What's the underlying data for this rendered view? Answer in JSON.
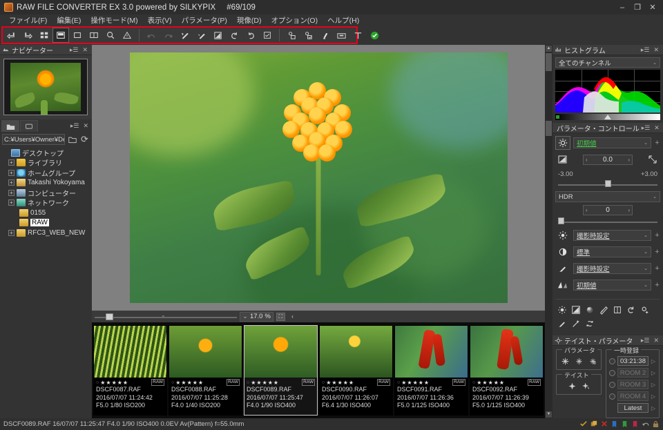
{
  "window": {
    "title": "RAW FILE CONVERTER EX 3.0 powered by SILKYPIX",
    "counter": "#69/109",
    "minimize": "–",
    "maximize": "❐",
    "close": "✕"
  },
  "menubar": [
    {
      "label": "ファイル(F)"
    },
    {
      "label": "編集(E)"
    },
    {
      "label": "操作モード(M)"
    },
    {
      "label": "表示(V)"
    },
    {
      "label": "パラメータ(P)"
    },
    {
      "label": "現像(D)"
    },
    {
      "label": "オプション(O)"
    },
    {
      "label": "ヘルプ(H)"
    }
  ],
  "toolbar": {
    "highlight_color": "#e8001a",
    "group1": [
      {
        "name": "prev-image-icon",
        "glyph": "⇤"
      },
      {
        "name": "next-image-icon",
        "glyph": "⇥"
      },
      {
        "name": "thumbnail-grid-icon",
        "glyph": "▦"
      },
      {
        "name": "filmstrip-view-icon",
        "glyph": "▤"
      },
      {
        "name": "single-view-icon",
        "glyph": "▢"
      },
      {
        "name": "split-view-icon",
        "glyph": "◫"
      },
      {
        "name": "magnifier-icon",
        "glyph": "🔍"
      },
      {
        "name": "warning-icon",
        "glyph": "⚠"
      }
    ],
    "group2": [
      {
        "name": "undo-icon",
        "glyph": "↶"
      },
      {
        "name": "redo-icon",
        "glyph": "↷"
      },
      {
        "name": "white-balance-icon",
        "glyph": "◩"
      },
      {
        "name": "gray-balance-icon",
        "glyph": "◪"
      },
      {
        "name": "exposure-icon",
        "glyph": "◨"
      },
      {
        "name": "rotate-left-icon",
        "glyph": "↺"
      },
      {
        "name": "rotate-right-icon",
        "glyph": "↻"
      },
      {
        "name": "check-box-icon",
        "glyph": "☑"
      }
    ],
    "group3": [
      {
        "name": "develop-one-icon",
        "glyph": "⚙"
      },
      {
        "name": "develop-batch-icon",
        "glyph": "⚙"
      },
      {
        "name": "brush-icon",
        "glyph": "🖌"
      },
      {
        "name": "printer-icon",
        "glyph": "🖶"
      },
      {
        "name": "lens-correction-icon",
        "glyph": "⊤"
      },
      {
        "name": "apply-ok-icon",
        "glyph": "✔"
      }
    ]
  },
  "navigator": {
    "title": "ナビゲーター",
    "menu_icon": "▸☰",
    "close_icon": "✕"
  },
  "folder_panel": {
    "tab_folder_icon": "📂",
    "tab_comment_icon": "🗩",
    "menu_icon": "▸☰",
    "close_icon": "✕",
    "path": "C:¥Users¥Owner¥De",
    "path_caret": "⌄",
    "new_folder_icon": "🗀",
    "refresh_icon": "⟳",
    "tree": [
      {
        "label": "デスクトップ",
        "depth": 0,
        "expander": "",
        "icon": "ico-desktop",
        "selected": false
      },
      {
        "label": "ライブラリ",
        "depth": 1,
        "expander": "+",
        "icon": "ico-folder",
        "selected": false
      },
      {
        "label": "ホームグループ",
        "depth": 1,
        "expander": "+",
        "icon": "ico-home",
        "selected": false
      },
      {
        "label": "Takashi Yokoyama",
        "depth": 1,
        "expander": "+",
        "icon": "ico-user",
        "selected": false
      },
      {
        "label": "コンピューター",
        "depth": 1,
        "expander": "+",
        "icon": "ico-comp",
        "selected": false
      },
      {
        "label": "ネットワーク",
        "depth": 1,
        "expander": "+",
        "icon": "ico-net",
        "selected": false
      },
      {
        "label": "0155",
        "depth": 2,
        "expander": "",
        "icon": "ico-folder-b",
        "selected": false
      },
      {
        "label": "RAW",
        "depth": 2,
        "expander": "",
        "icon": "ico-folder-b",
        "selected": true
      },
      {
        "label": "RFC3_WEB_NEW",
        "depth": 1,
        "expander": "+",
        "icon": "ico-folder-b",
        "selected": false
      }
    ]
  },
  "viewer": {
    "zoom_value": "17.0",
    "zoom_unit": "%",
    "zoom_caret": "⌄",
    "zoom_fit_icon": "⛶",
    "zoom_prev_icon": "‹"
  },
  "filmstrip": {
    "items": [
      {
        "filename": "DSCF0087.RAF",
        "datetime": "2016/07/07 11:24:42",
        "exif": "F5.0 1/80 ISO200",
        "rating": 5,
        "badge": "RAW",
        "selected": false,
        "kind": "fern"
      },
      {
        "filename": "DSCF0088.RAF",
        "datetime": "2016/07/07 11:25:28",
        "exif": "F4.0 1/40 ISO200",
        "rating": 5,
        "badge": "RAW",
        "selected": false,
        "kind": "lantana"
      },
      {
        "filename": "DSCF0089.RAF",
        "datetime": "2016/07/07 11:25:47",
        "exif": "F4.0 1/90 ISO400",
        "rating": 5,
        "badge": "RAW",
        "selected": true,
        "kind": "lantana"
      },
      {
        "filename": "DSCF0090.RAF",
        "datetime": "2016/07/07 11:26:07",
        "exif": "F6.4 1/30 ISO400",
        "rating": 5,
        "badge": "RAW",
        "selected": false,
        "kind": "lantana"
      },
      {
        "filename": "DSCF0091.RAF",
        "datetime": "2016/07/07 11:26:36",
        "exif": "F5.0 1/125 ISO400",
        "rating": 5,
        "badge": "RAW",
        "selected": false,
        "kind": "red"
      },
      {
        "filename": "DSCF0092.RAF",
        "datetime": "2016/07/07 11:26:39",
        "exif": "F5.0 1/125 ISO400",
        "rating": 5,
        "badge": "RAW",
        "selected": false,
        "kind": "red"
      }
    ],
    "star_glyph": "★",
    "empty_star_glyph": "○"
  },
  "histogram": {
    "title": "ヒストグラム",
    "menu_icon": "▸☰",
    "close_icon": "✕",
    "channel": "全てのチャンネル",
    "caret": "⌄"
  },
  "parameter_control": {
    "title": "パラメータ・コントロール",
    "menu_icon": "▸☰",
    "close_icon": "✕",
    "preset": {
      "icon": "gear-icon",
      "value": "初期値",
      "caret": "⌄",
      "plus": "+"
    },
    "exposure": {
      "icon": "exposure-icon",
      "value": "0.0",
      "dec": "‹",
      "inc": "›",
      "right_icon": "highlight-icon",
      "min_label": "-3.00",
      "max_label": "+3.00"
    },
    "hdr": {
      "label": "HDR",
      "caret": "⌄",
      "value": "0",
      "dec": "‹",
      "inc": "›"
    },
    "rows": [
      {
        "icon": "white-balance-icon",
        "value": "撮影時設定",
        "caret": "⌄",
        "plus": "+"
      },
      {
        "icon": "contrast-icon",
        "value": "標準",
        "caret": "⌄",
        "plus": "+"
      },
      {
        "icon": "color-icon",
        "value": "撮影時設定",
        "caret": "⌄",
        "plus": "+"
      },
      {
        "icon": "tone-curve-icon",
        "value": "初期値",
        "caret": "⌄",
        "plus": "+"
      }
    ],
    "tool_icons_row1": [
      {
        "name": "highlight-controller-icon",
        "glyph": "☀"
      },
      {
        "name": "tone-curve-icon",
        "glyph": "◪"
      },
      {
        "name": "sharpness-icon",
        "glyph": "●"
      },
      {
        "name": "noise-reduction-icon",
        "glyph": "◩"
      },
      {
        "name": "crop-icon",
        "glyph": "⛶"
      },
      {
        "name": "rotation-icon",
        "glyph": "↺"
      },
      {
        "name": "settings-plus-icon",
        "glyph": "⚙"
      }
    ],
    "tool_icons_row2": [
      {
        "name": "brush-tool-icon",
        "glyph": "╱"
      },
      {
        "name": "magic-wand-icon",
        "glyph": "✨"
      },
      {
        "name": "reset-icon",
        "glyph": "♺"
      }
    ]
  },
  "taste_parameter": {
    "title": "テイスト・パラメータ",
    "menu_icon": "▸☰",
    "close_icon": "✕",
    "parameter_legend": "パラメータ",
    "parameter_icons": [
      {
        "name": "param-copy-icon",
        "glyph": "✲"
      },
      {
        "name": "param-paste-icon",
        "glyph": "✳"
      },
      {
        "name": "param-reset-icon",
        "glyph": "✺"
      }
    ],
    "taste_legend": "テイスト",
    "taste_icons": [
      {
        "name": "taste-apply-icon",
        "glyph": "✦"
      },
      {
        "name": "taste-save-icon",
        "glyph": "✧"
      }
    ],
    "temp_legend": "一時登録",
    "rooms": [
      {
        "label": "03:21:38",
        "dim": false,
        "radio": true,
        "arrow": "▷"
      },
      {
        "label": "ROOM 2",
        "dim": true,
        "radio": true,
        "arrow": "▷"
      },
      {
        "label": "ROOM 3",
        "dim": true,
        "radio": true,
        "arrow": "▷"
      },
      {
        "label": "ROOM 4",
        "dim": true,
        "radio": true,
        "arrow": "▷"
      }
    ],
    "latest": {
      "label": "Latest",
      "arrow": "▷"
    }
  },
  "statusbar": {
    "text": "DSCF0089.RAF 16/07/07 11:25:47 F4.0 1/90 ISO400  0.0EV Av(Pattern) f=55.0mm",
    "icons": [
      {
        "name": "check-icon",
        "color": "#c8a12a",
        "glyph": "✓"
      },
      {
        "name": "copy-icon",
        "color": "#b88830",
        "glyph": "▤"
      },
      {
        "name": "delete-icon",
        "color": "#cc2a2a",
        "glyph": "✕"
      },
      {
        "name": "blue-tag-icon",
        "color": "#2a6fc0",
        "glyph": "▮"
      },
      {
        "name": "green-tag-icon",
        "color": "#2f9a3a",
        "glyph": "▮"
      },
      {
        "name": "red-tag-icon",
        "color": "#b8274a",
        "glyph": "▮"
      },
      {
        "name": "undo-icon",
        "color": "#a0a0a0",
        "glyph": "↺"
      },
      {
        "name": "lock-icon",
        "color": "#9a8050",
        "glyph": "🔒"
      }
    ]
  }
}
